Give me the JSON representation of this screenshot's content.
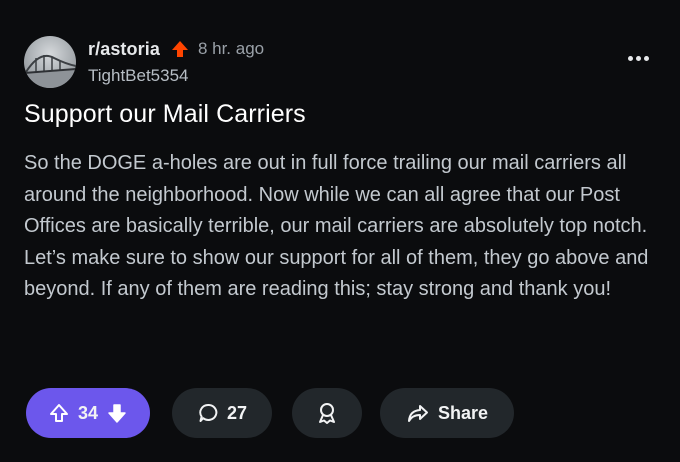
{
  "post": {
    "subreddit": "r/astoria",
    "time_ago": "8 hr. ago",
    "username": "TightBet5354",
    "title": "Support our Mail Carriers",
    "body": "So the DOGE a-holes are out in full force trailing our mail carriers all around the neighborhood. Now while we can all agree that our Post Offices are basically terrible, our mail carriers are absolutely top notch. Let’s make sure to show our support for all of them, they go above and beyond. If any of them are reading this; stay strong and thank you!"
  },
  "actions": {
    "vote_count": "34",
    "comment_count": "27",
    "share_label": "Share"
  },
  "icons": {
    "upvote_indicator": "up-arrow-icon",
    "more": "more-options-icon",
    "upvote": "arrow-up-icon",
    "downvote": "arrow-down-icon",
    "comment": "comment-bubble-icon",
    "award": "award-icon",
    "share": "share-arrow-icon"
  },
  "colors": {
    "vote_pill": "#6c57ec",
    "upvote_indicator": "#ff4500",
    "pill_background": "#22272b",
    "background": "#0b0c0e"
  }
}
